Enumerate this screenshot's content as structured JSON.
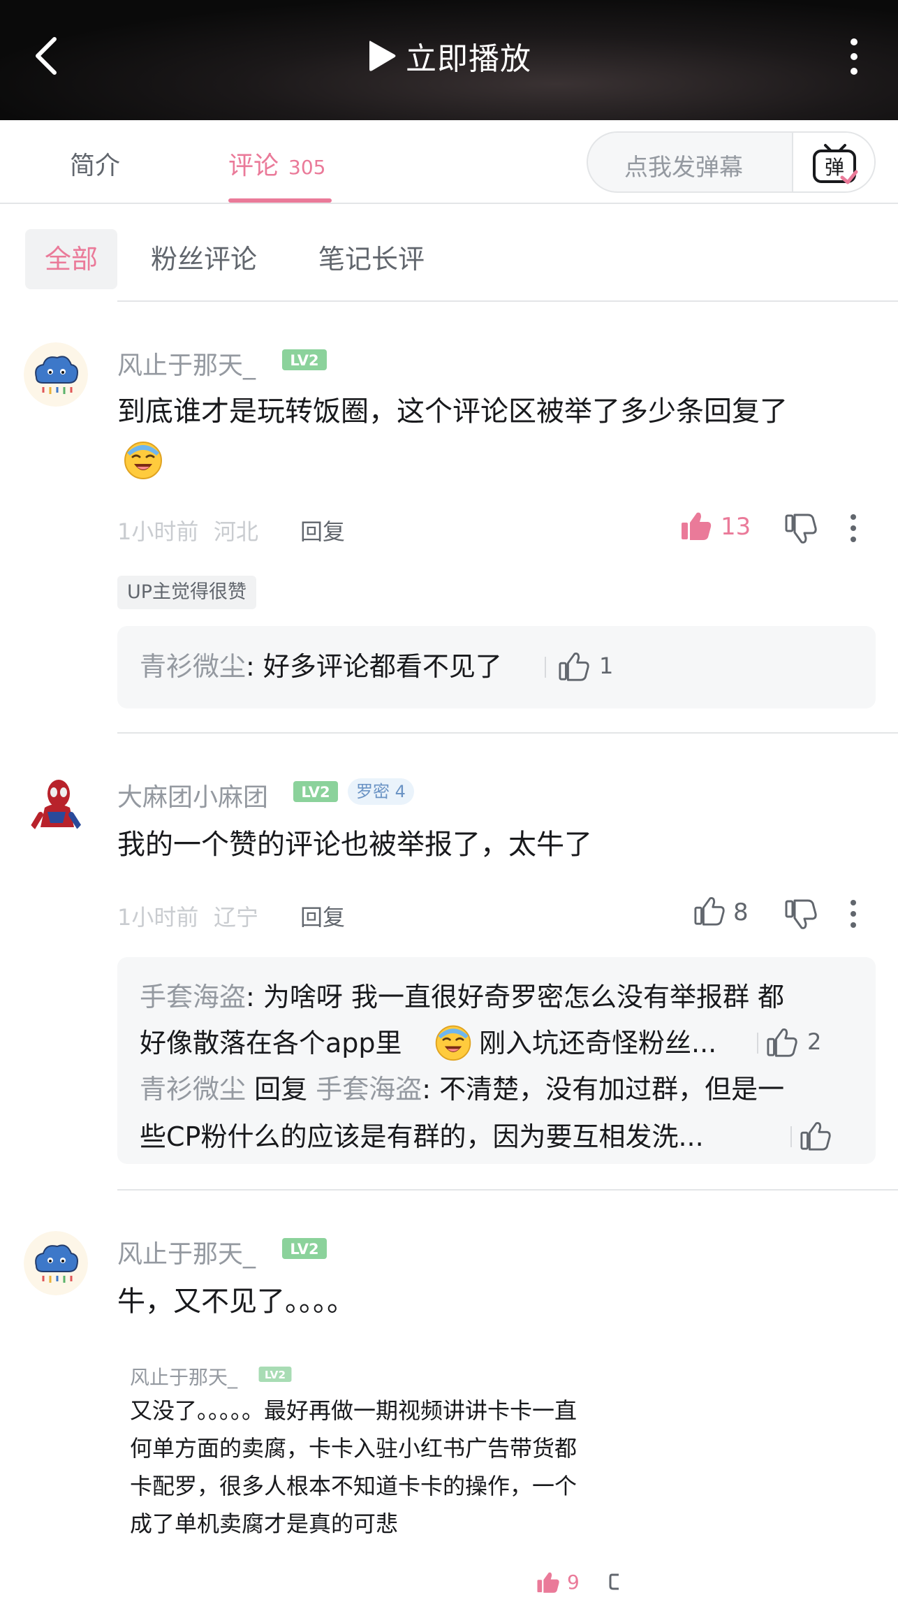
{
  "header": {
    "play_label": "立即播放"
  },
  "tabs": {
    "intro": "简介",
    "comments": "评论",
    "comments_count": "305",
    "danmaku_placeholder": "点我发弹幕",
    "danmaku_button": "弹"
  },
  "filters": [
    "全部",
    "粉丝评论",
    "笔记长评"
  ],
  "colors": {
    "accent_pink": "#ea7a99",
    "level_green": "#8bd29b",
    "gray_text": "#9499a0"
  },
  "comments": [
    {
      "user": "风止于那天_",
      "level": "LV2",
      "text_line1": "到底谁才是玩转饭圈，这个评论区被举了多少条回复了",
      "emoji": "laughing-crying-emoji",
      "time": "1小时前",
      "location": "河北",
      "reply_label": "回复",
      "likes": "13",
      "up_tag": "UP主觉得很赞",
      "replies": [
        {
          "user": "青衫微尘",
          "text": ": 好多评论都看不见了",
          "likes": "1"
        }
      ]
    },
    {
      "user": "大麻团小麻团",
      "level": "LV2",
      "medal": "罗密 4",
      "text": "我的一个赞的评论也被举报了，太牛了",
      "time": "1小时前",
      "location": "辽宁",
      "reply_label": "回复",
      "likes": "8",
      "replies": [
        {
          "user": "手套海盗",
          "line1": ": 为啥呀 我一直很好奇罗密怎么没有举报群  都",
          "line2a": "好像散落在各个app里",
          "line2b": "刚入坑还奇怪粉丝...",
          "likes": "2"
        },
        {
          "user": "青衫微尘",
          "reply_word": " 回复 ",
          "target": "手套海盗",
          "line1": ": 不清楚，没有加过群，但是一",
          "line2": "些CP粉什么的应该是有群的，因为要互相发洗..."
        }
      ]
    },
    {
      "user": "风止于那天_",
      "level": "LV2",
      "text": "牛，又不见了。。。。",
      "embedded": {
        "user": "风止于那天_",
        "level": "LV2",
        "lines": [
          "又没了。。。。。最好再做一期视频讲讲卡卡一直",
          "何单方面的卖腐，卡卡入驻小红书广告带货都",
          "卡配罗，很多人根本不知道卡卡的操作，一个",
          "成了单机卖腐才是真的可悲"
        ],
        "likes": "9"
      }
    }
  ]
}
